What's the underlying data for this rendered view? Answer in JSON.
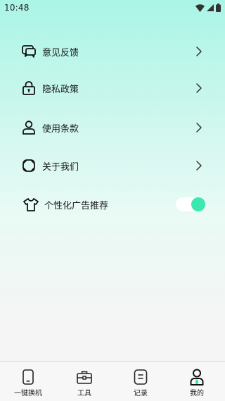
{
  "status_bar": {
    "time": "10:48",
    "icons": [
      "wifi-icon",
      "cellular-signal-icon",
      "battery-icon"
    ]
  },
  "menu": {
    "items": [
      {
        "label": "意见反馈",
        "icon": "feedback-icon",
        "trailing": "chevron"
      },
      {
        "label": "隐私政策",
        "icon": "lock-icon",
        "trailing": "chevron"
      },
      {
        "label": "使用条款",
        "icon": "user-icon",
        "trailing": "chevron"
      },
      {
        "label": "关于我们",
        "icon": "about-icon",
        "trailing": "chevron"
      },
      {
        "label": "个性化广告推荐",
        "icon": "shirt-icon",
        "trailing": "toggle",
        "toggle_on": true
      }
    ]
  },
  "tab_bar": {
    "tabs": [
      {
        "label": "一键换机",
        "icon": "phone-icon",
        "active": false
      },
      {
        "label": "工具",
        "icon": "toolbox-icon",
        "active": false
      },
      {
        "label": "记录",
        "icon": "record-icon",
        "active": false
      },
      {
        "label": "我的",
        "icon": "profile-icon",
        "active": true
      }
    ]
  },
  "colors": {
    "accent": "#3be8b0",
    "gradient_top": "#aaf5e6",
    "background": "#f5f5f5"
  }
}
